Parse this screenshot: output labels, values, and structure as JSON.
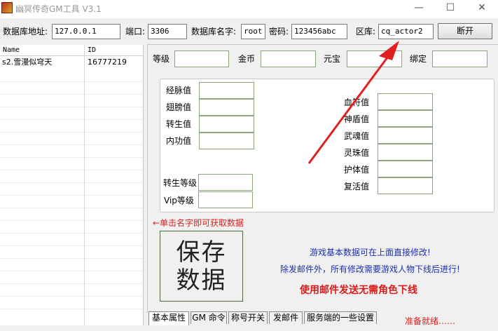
{
  "window": {
    "title": "幽冥传奇GM工具 V3.1",
    "minimize": "—",
    "maximize": "☐",
    "close": "✕"
  },
  "connection": {
    "host_label": "数据库地址:",
    "host_value": "127.0.0.1",
    "port_label": "端口:",
    "port_value": "3306",
    "dbname_label": "数据库名字:",
    "dbname_value": "root",
    "password_label": "密码:",
    "password_value": "123456abc",
    "zone_label": "区库:",
    "zone_value": "cq_actor2",
    "disconnect_button": "断开"
  },
  "player_list": {
    "columns": [
      "Name",
      "ID"
    ],
    "rows": [
      {
        "name": "s2.雪漫似穹天",
        "id": "16777219"
      }
    ]
  },
  "top_fields": {
    "level": "等级",
    "gold": "金币",
    "yuanbao": "元宝",
    "bound": "绑定"
  },
  "left_stats": [
    "经脉值",
    "翅膀值",
    "转生值",
    "内功值"
  ],
  "right_stats": [
    "血符值",
    "神盾值",
    "武魂值",
    "灵珠值",
    "护体值",
    "复活值"
  ],
  "rebirth_level": "转生等级",
  "vip_level": "Vip等级",
  "hint_click_name": "←单击名字即可获取数据",
  "save_button": "保存数据",
  "notices": {
    "line1": "游戏基本数据可在上面直接修改!",
    "line2": "除发邮件外，所有修改需要游戏人物下线后进行!",
    "line3": "使用邮件发送无需角色下线"
  },
  "tabs": [
    "基本属性",
    "GM 命令",
    "称号开关",
    "发邮件",
    "服务端的一些设置"
  ],
  "status": "准备就绪……",
  "colors": {
    "annotation_arrow": "#e02020",
    "notice_blue": "#1a2fb0",
    "notice_red": "#d81b1b"
  }
}
